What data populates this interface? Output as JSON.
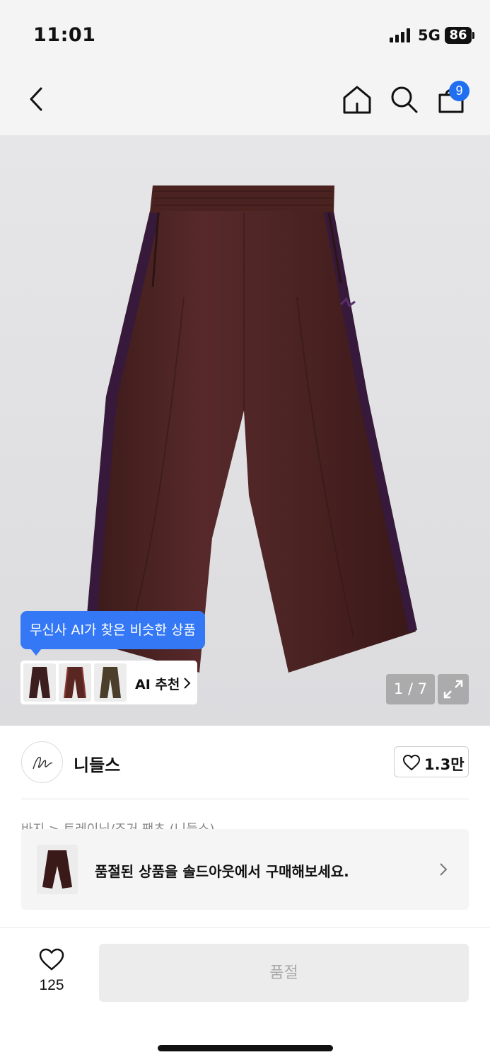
{
  "status_bar": {
    "time": "11:01",
    "network": "5G",
    "battery": "86"
  },
  "nav": {
    "icons": [
      "back-arrow-icon",
      "home-icon",
      "search-icon",
      "shopping-bag-icon"
    ],
    "cart_count": "9"
  },
  "gallery": {
    "ai_tooltip": "무신사 AI가 찾은 비슷한 상품",
    "ai_recommend_label": "AI 추천",
    "page_counter": "1 / 7",
    "product_color": "#4a2220",
    "stripe_color": "#3a1e3e"
  },
  "brand": {
    "name": "니들스",
    "like_count": "1.3만"
  },
  "breadcrumb": "바지 > 트레이닝/조거 팬츠 (니들스)",
  "soldout_banner": {
    "text": "품절된 상품을 솔드아웃에서 구매해보세요."
  },
  "footer": {
    "wish_count": "125",
    "buy_button": "품절"
  }
}
